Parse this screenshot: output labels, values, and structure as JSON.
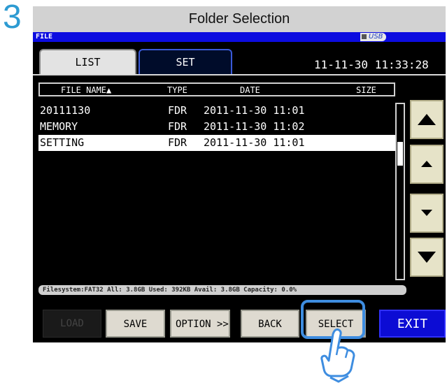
{
  "step_number": "3",
  "caption": "Folder Selection",
  "window": {
    "title": "FILE",
    "usb_label": "USB"
  },
  "tabs": [
    {
      "label": "LIST",
      "active": true
    },
    {
      "label": "SET",
      "active": false
    }
  ],
  "clock": "11-11-30 11:33:28",
  "table": {
    "headers": {
      "name": "FILE NAME▲",
      "type": "TYPE",
      "date": "DATE",
      "size": "SIZE"
    },
    "rows": [
      {
        "name": "20111130",
        "type": "FDR",
        "date": "2011-11-30 11:01",
        "selected": false
      },
      {
        "name": "MEMORY",
        "type": "FDR",
        "date": "2011-11-30 11:02",
        "selected": false
      },
      {
        "name": "SETTING",
        "type": "FDR",
        "date": "2011-11-30 11:01",
        "selected": true
      }
    ]
  },
  "scroll_buttons": [
    "page-up-icon",
    "line-up-icon",
    "line-down-icon",
    "page-down-icon"
  ],
  "status": "Filesystem:FAT32 All: 3.8GB Used: 392KB Avail: 3.8GB Capacity: 0.0%",
  "buttons": {
    "load": "LOAD",
    "save": "SAVE",
    "option": "OPTION >>",
    "back": "BACK",
    "select": "SELECT",
    "exit": "EXIT"
  },
  "colors": {
    "accent": "#2d9bd2",
    "exit_button": "#0c0cd4",
    "title_bar": "#0c0ce0"
  }
}
